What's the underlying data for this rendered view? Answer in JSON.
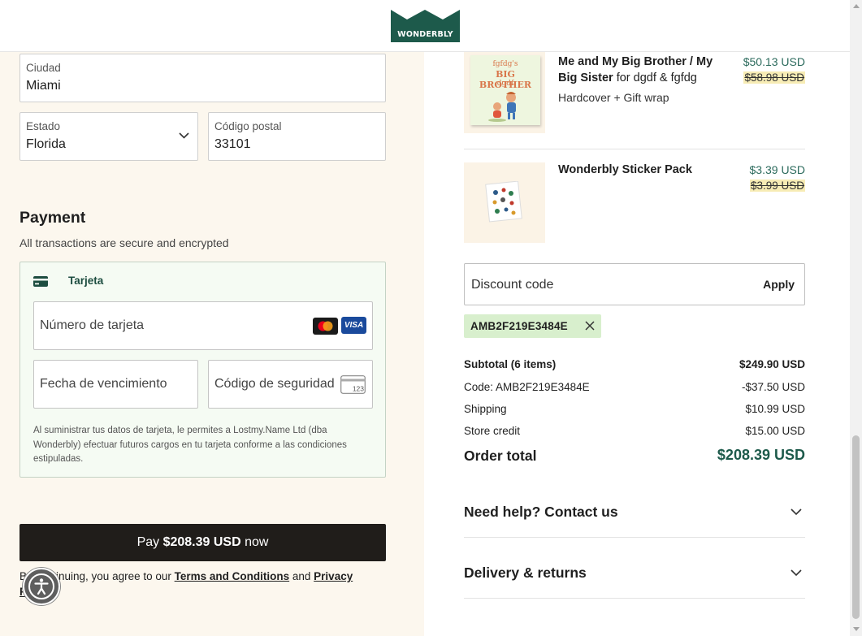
{
  "header": {
    "logo_text": "WONDERBLY"
  },
  "address": {
    "city": {
      "label": "Ciudad",
      "value": "Miami"
    },
    "state": {
      "label": "Estado",
      "value": "Florida"
    },
    "zip": {
      "label": "Código postal",
      "value": "33101"
    }
  },
  "payment": {
    "title": "Payment",
    "subtitle": "All transactions are secure and encrypted",
    "method_label": "Tarjeta",
    "card_number_placeholder": "Número de tarjeta",
    "expiry_placeholder": "Fecha de vencimiento",
    "cvv_placeholder": "Código de seguridad",
    "cvv_icon_text": "123",
    "visa_text": "VISA",
    "legal": "Al suministrar tus datos de tarjeta, le permites a Lostmy.Name Ltd (dba Wonderbly) efectuar futuros cargos en tu tarjeta conforme a las condiciones estipuladas.",
    "pay_button_prefix": "Pay ",
    "pay_button_amount": "$208.39 USD",
    "pay_button_suffix": " now",
    "agree_text": "By continuing, you agree to our ",
    "terms_link": "Terms and Conditions",
    "and_text": " and ",
    "privacy_link": "Privacy Policy"
  },
  "cart": {
    "items": [
      {
        "name": "Me and My Big Brother / My Big Sister",
        "for_text": " for dgdf & fgfdg",
        "variant": "Hardcover + Gift wrap",
        "price": "$50.13 USD",
        "old_price": "$58.98 USD",
        "cover_line1": "fgfdg's",
        "cover_line2": "BIG BROTHER",
        "cover_line3": "dgdf"
      },
      {
        "name": "Wonderbly Sticker Pack",
        "price": "$3.39 USD",
        "old_price": "$3.99 USD"
      }
    ],
    "discount_placeholder": "Discount code",
    "apply_label": "Apply",
    "applied_code": "AMB2F219E3484E",
    "summary": {
      "subtotal_label": "Subtotal (6 items)",
      "subtotal_value": "$249.90 USD",
      "code_label": "Code: AMB2F219E3484E",
      "code_value": "-$37.50 USD",
      "shipping_label": "Shipping",
      "shipping_value": "$10.99 USD",
      "credit_label": "Store credit",
      "credit_value": "$15.00 USD",
      "total_label": "Order total",
      "total_value": "$208.39 USD"
    },
    "help_title": "Need help? Contact us",
    "delivery_title": "Delivery & returns"
  },
  "colors": {
    "brand_green": "#1d5a4b",
    "price_green": "#2b6a5c",
    "left_bg": "#fcf7ee",
    "pay_button": "#201d1a",
    "chip_bg": "#d8efcd",
    "strike_highlight": "#f7ecb5"
  }
}
